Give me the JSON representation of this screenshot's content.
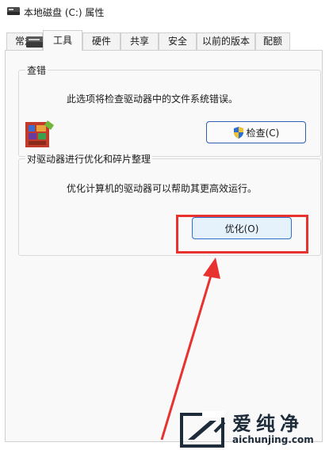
{
  "window": {
    "title": "本地磁盘 (C:) 属性"
  },
  "tabs": [
    {
      "label": "常规"
    },
    {
      "label": "工具"
    },
    {
      "label": "硬件"
    },
    {
      "label": "共享"
    },
    {
      "label": "安全"
    },
    {
      "label": "以前的版本"
    },
    {
      "label": "配额"
    }
  ],
  "active_tab": "工具",
  "error_check": {
    "title": "查错",
    "description": "此选项将检查驱动器中的文件系统错误。",
    "button_label": "检查(C)"
  },
  "optimize": {
    "title": "对驱动器进行优化和碎片整理",
    "description": "优化计算机的驱动器可以帮助其更高效运行。",
    "button_label": "优化(O)"
  },
  "watermark": {
    "brand": "爱纯净",
    "url": "aichunjing.com"
  },
  "colors": {
    "highlight": "#e8322f",
    "button_border": "#2f5fb0",
    "watermark": "#1d2b3a"
  }
}
